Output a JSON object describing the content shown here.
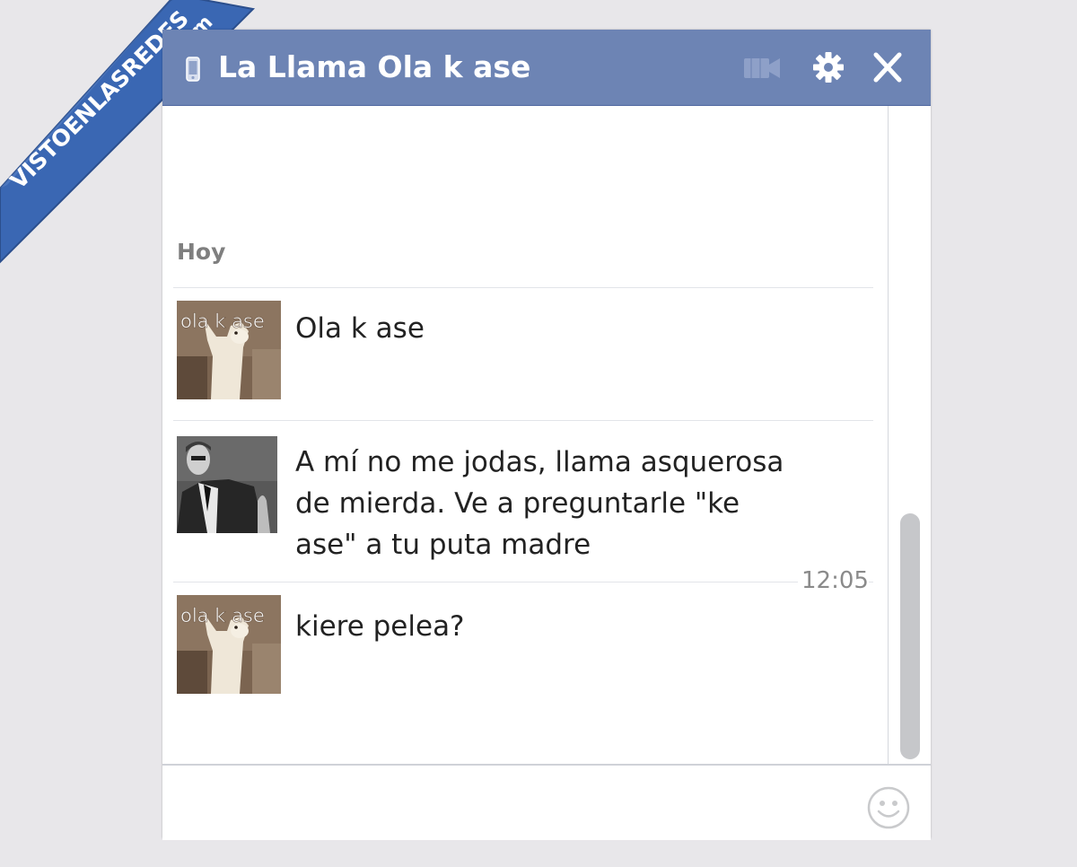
{
  "watermark": {
    "site": "VISTOENLASREDES",
    "tld": ".com"
  },
  "chat": {
    "title": "La Llama Ola k ase",
    "date_label": "Hoy",
    "messages": [
      {
        "avatar": "llama-avatar",
        "avatar_caption": "ola k ase",
        "lines": [
          "Ola k ase"
        ]
      },
      {
        "avatar": "man-in-suit-avatar",
        "lines": [
          "A mí no me jodas, llama asquerosa",
          "de mierda. Ve a preguntarle \"ke",
          "ase\" a tu puta madre"
        ]
      },
      {
        "avatar": "llama-avatar",
        "avatar_caption": "ola k ase",
        "lines": [
          "kiere pelea?"
        ]
      }
    ],
    "timestamp": "12:05"
  },
  "icons": {
    "title": "phone-icon",
    "video": "video-camera-icon",
    "settings": "gear-icon",
    "close": "close-icon",
    "composer": "smiley-icon"
  },
  "colors": {
    "titlebar": "#6d84b4",
    "titlebar_text": "#ffffff",
    "watermark": "#3a67b3"
  }
}
